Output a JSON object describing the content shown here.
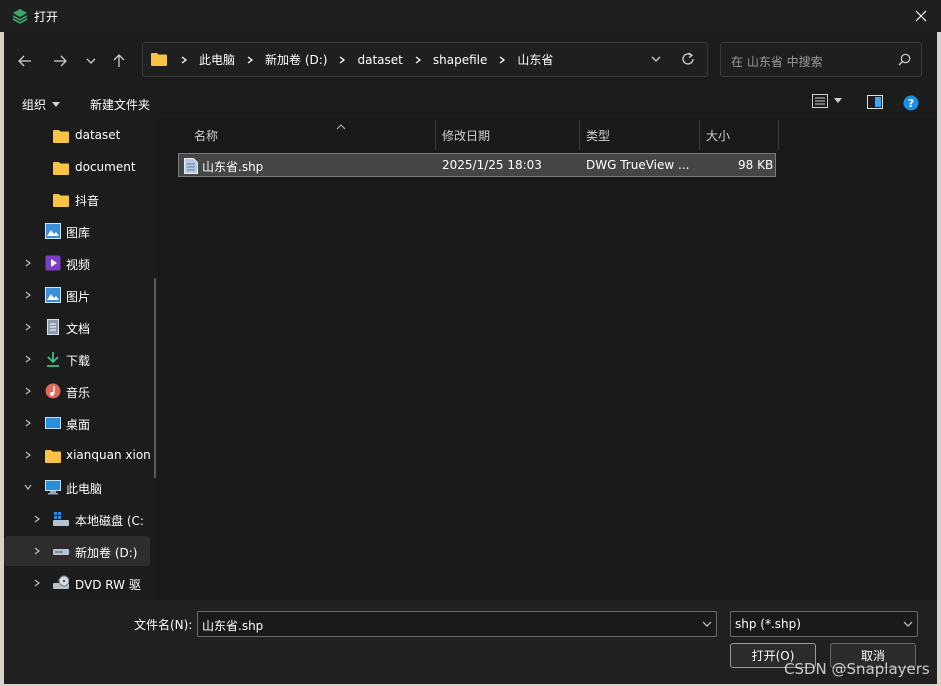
{
  "window": {
    "title": "打开"
  },
  "navigation": {
    "breadcrumbs": [
      "此电脑",
      "新加卷 (D:)",
      "dataset",
      "shapefile",
      "山东省"
    ],
    "search_placeholder": "在 山东省 中搜索"
  },
  "toolbar": {
    "organize_label": "组织",
    "new_folder_label": "新建文件夹"
  },
  "sidebar": {
    "items": [
      {
        "label": "dataset",
        "icon": "folder-icon",
        "expandable": false,
        "indent": 2
      },
      {
        "label": "document",
        "icon": "folder-icon",
        "expandable": false,
        "indent": 2
      },
      {
        "label": "抖音",
        "icon": "folder-icon",
        "expandable": false,
        "indent": 2
      },
      {
        "label": "图库",
        "icon": "gallery-icon",
        "expandable": false,
        "indent": 1
      },
      {
        "label": "视频",
        "icon": "video-icon",
        "expandable": true,
        "indent": 1
      },
      {
        "label": "图片",
        "icon": "pictures-icon",
        "expandable": true,
        "indent": 1
      },
      {
        "label": "文档",
        "icon": "documents-icon",
        "expandable": true,
        "indent": 1
      },
      {
        "label": "下载",
        "icon": "download-icon",
        "expandable": true,
        "indent": 1
      },
      {
        "label": "音乐",
        "icon": "music-icon",
        "expandable": true,
        "indent": 1
      },
      {
        "label": "桌面",
        "icon": "desktop-icon",
        "expandable": true,
        "indent": 1
      },
      {
        "label": "xianquan xion",
        "icon": "folder-icon",
        "expandable": true,
        "indent": 1
      },
      {
        "label": "此电脑",
        "icon": "computer-icon",
        "expandable": true,
        "expanded": true,
        "indent": 1
      },
      {
        "label": "本地磁盘 (C:",
        "icon": "local-disk-icon",
        "expandable": true,
        "indent": 2
      },
      {
        "label": "新加卷 (D:)",
        "icon": "drive-icon",
        "expandable": true,
        "indent": 2,
        "selected": true
      },
      {
        "label": "DVD RW 驱",
        "icon": "dvd-drive-icon",
        "expandable": true,
        "indent": 2
      }
    ]
  },
  "file_list": {
    "columns": [
      "名称",
      "修改日期",
      "类型",
      "大小"
    ],
    "rows": [
      {
        "name": "山东省.shp",
        "modified": "2025/1/25 18:03",
        "type": "DWG TrueView ...",
        "size": "98 KB",
        "icon": "file-icon",
        "selected": true
      }
    ]
  },
  "footer": {
    "filename_label": "文件名(N):",
    "filename_value": "山东省.shp",
    "filetype_value": "shp (*.shp)",
    "open_label": "打开(O)",
    "cancel_label": "取消"
  },
  "watermark": "CSDN @Snaplayers",
  "colors": {
    "background": "#1c1c1c",
    "accent": "#1a8fe3",
    "folder": "#f6c344"
  }
}
